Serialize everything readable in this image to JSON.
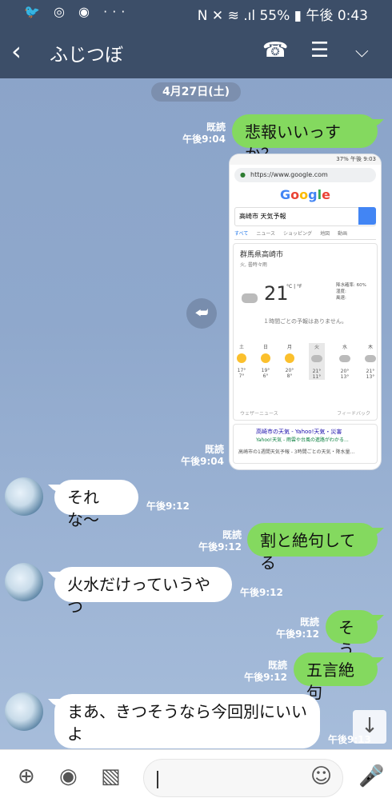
{
  "status_bar": {
    "left_icons": "🐦 ◎ ◉ ···",
    "right_text": "N ✕ ≋ .ıl 55% ▮ 午後 0:43"
  },
  "header": {
    "back_icon": "chevron-left-icon",
    "title": "ふじつぼ",
    "icons": [
      "phone-icon",
      "note-icon",
      "chevron-down-icon"
    ]
  },
  "date_label": "4月27日(土)",
  "messages": [
    {
      "side": "right",
      "read": "既読",
      "time": "午後9:04",
      "text": "悲報いいっすか？"
    },
    {
      "side": "right",
      "read": "既読",
      "time": "午後9:04",
      "type": "image"
    },
    {
      "side": "left",
      "time": "午後9:12",
      "text": "それな〜"
    },
    {
      "side": "right",
      "read": "既読",
      "time": "午後9:12",
      "text": "割と絶句してる"
    },
    {
      "side": "left",
      "time": "午後9:12",
      "text": "火水だけっていうやつ"
    },
    {
      "side": "right",
      "read": "既読",
      "time": "午後9:12",
      "text": "そう"
    },
    {
      "side": "right",
      "read": "既読",
      "time": "午後9:12",
      "text": "五言絶句"
    },
    {
      "side": "left",
      "time": "午後9:13",
      "text": "まあ、きつそうなら今回別にいいよ"
    }
  ],
  "screenshot": {
    "status": "37% 午後 9:03",
    "url": "https://www.google.com",
    "google": "Google",
    "query": "高崎市 天気予報",
    "tabs": [
      "すべて",
      "ニュース",
      "ショッピング",
      "地図",
      "動画"
    ],
    "location": "群馬県高崎市",
    "condition": "火, 曇時々雨",
    "temperature": "21",
    "unit": "°C | °F",
    "details": [
      "降水確率: 60%",
      "湿度:",
      "風速:"
    ],
    "no_forecast": "１時間ごとの予報はありません。",
    "days": [
      "土",
      "日",
      "月",
      "火",
      "水",
      "木"
    ],
    "highs": [
      "17°",
      "19°",
      "20°",
      "21°",
      "20°",
      "21°"
    ],
    "lows": [
      "7°",
      "6°",
      "8°",
      "11°",
      "13°",
      "13°"
    ],
    "footer_left": "ウェザーニュース",
    "footer_right": "フィードバック",
    "news_title": "高崎市の天気 - Yahoo!天気・災害",
    "news_sub": "Yahoo!天気 - 雨雲や台風の進路がわかる...",
    "news_more": "高崎市の1週間天気予報 - 3時間ごとの天気・降水量..."
  },
  "input_bar": {
    "icons": [
      "plus-icon",
      "camera-icon",
      "image-icon",
      "emoji-icon",
      "microphone-icon"
    ],
    "placeholder": ""
  }
}
